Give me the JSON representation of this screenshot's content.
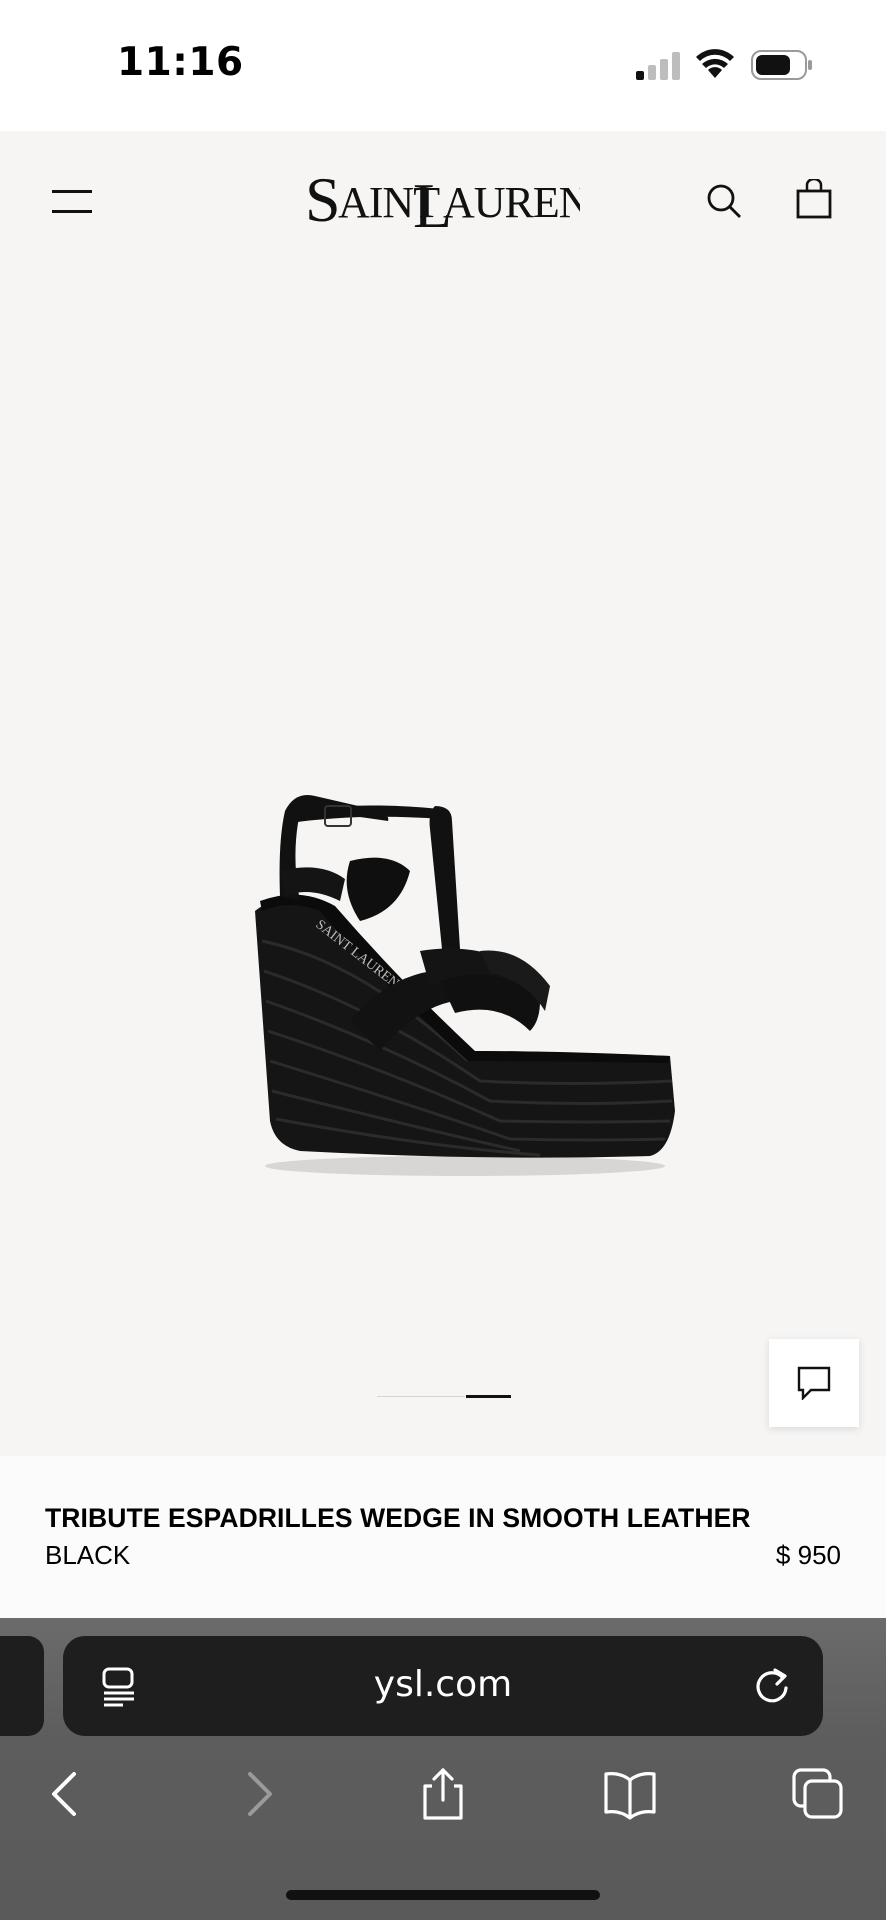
{
  "status_bar": {
    "time": "11:16",
    "icons": [
      "cellular-signal-icon",
      "wifi-icon",
      "battery-icon"
    ]
  },
  "header": {
    "logo_text": "SAINT LAURENT",
    "icons": [
      "menu-icon",
      "search-icon",
      "shopping-bag-icon"
    ]
  },
  "gallery": {
    "image_subject": "black wedge espadrille sandal",
    "slide_count": 2,
    "active_slide": 2,
    "chat_icon": "chat-bubble-icon"
  },
  "product": {
    "name": "TRIBUTE ESPADRILLES WEDGE IN SMOOTH LEATHER",
    "color": "BLACK",
    "price": "$ 950"
  },
  "browser": {
    "url": "ysl.com",
    "icons": [
      "reader-mode-icon",
      "reload-icon",
      "back-arrow-icon",
      "forward-arrow-icon",
      "share-icon",
      "bookmarks-icon",
      "tabs-icon"
    ]
  },
  "colors": {
    "page_background": "#f6f5f4",
    "text": "#000000",
    "browser_chrome": "#5d5d5d",
    "url_field": "#1e1e1e"
  }
}
